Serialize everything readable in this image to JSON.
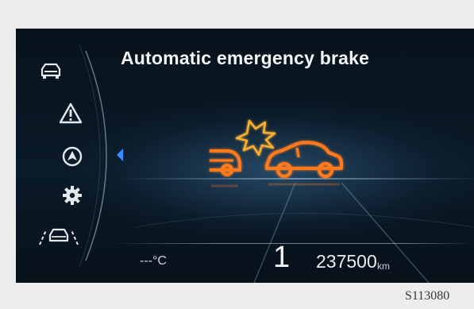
{
  "alert": {
    "title": "Automatic emergency brake"
  },
  "sidebar": {
    "icons": [
      "car-icon",
      "warning-icon",
      "navigation-icon",
      "settings-gear-icon",
      "driver-assist-icon"
    ],
    "selected": "navigation-icon"
  },
  "status": {
    "temperature": "---°C",
    "gear": "1",
    "odometer_value": "237500",
    "odometer_unit": "km"
  },
  "figure_code": "S113080",
  "colors": {
    "alert_orange": "#ff7a1a",
    "alert_yellow": "#ffb02e",
    "selection_blue": "#2f8fff",
    "background": "#07121c"
  }
}
